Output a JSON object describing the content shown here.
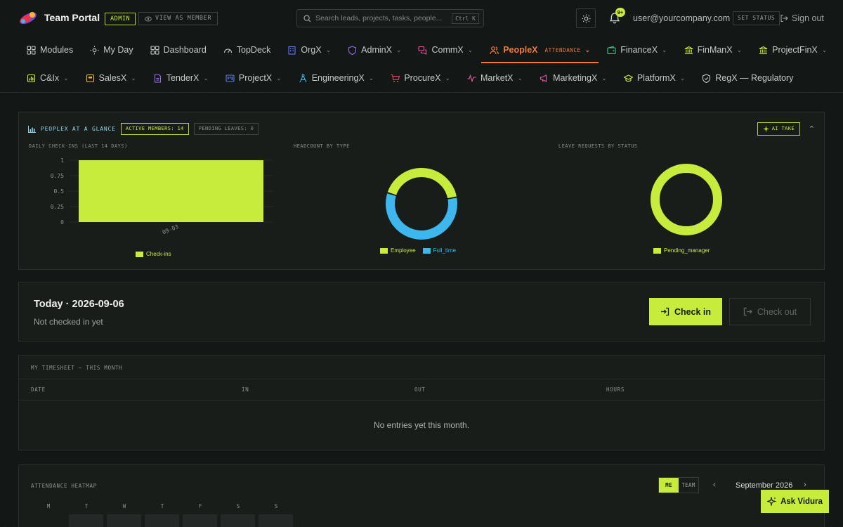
{
  "header": {
    "brand": "Team Portal",
    "role_badge": "ADMIN",
    "view_as_label": "VIEW AS MEMBER",
    "search_placeholder": "Search leads, projects, tasks, people...",
    "search_shortcut": "Ctrl K",
    "notification_count": "9+",
    "user_email": "user@yourcompany.com",
    "set_status_label": "SET STATUS",
    "sign_out_label": "Sign out"
  },
  "nav": {
    "row1": [
      {
        "label": "Modules",
        "icon": "grid-icon",
        "dropdown": false
      },
      {
        "label": "My Day",
        "icon": "sun-icon",
        "dropdown": false
      },
      {
        "label": "Dashboard",
        "icon": "grid-icon",
        "dropdown": false
      },
      {
        "label": "TopDeck",
        "icon": "gauge-icon",
        "dropdown": false
      },
      {
        "label": "OrgX",
        "icon": "building-icon",
        "dropdown": true
      },
      {
        "label": "AdminX",
        "icon": "shield-icon",
        "dropdown": true
      },
      {
        "label": "CommX",
        "icon": "chat-icon",
        "dropdown": true
      },
      {
        "label": "PeopleX",
        "icon": "people-icon",
        "dropdown": true,
        "active": true,
        "sub": "ATTENDANCE"
      },
      {
        "label": "FinanceX",
        "icon": "wallet-icon",
        "dropdown": true
      },
      {
        "label": "FinManX",
        "icon": "bank-icon",
        "dropdown": true
      },
      {
        "label": "ProjectFinX",
        "icon": "bank-icon",
        "dropdown": true
      }
    ],
    "row2": [
      {
        "label": "C&Ix",
        "icon": "flask-icon",
        "dropdown": true
      },
      {
        "label": "SalesX",
        "icon": "badge-icon",
        "dropdown": true
      },
      {
        "label": "TenderX",
        "icon": "document-icon",
        "dropdown": true
      },
      {
        "label": "ProjectX",
        "icon": "kanban-icon",
        "dropdown": true
      },
      {
        "label": "EngineeringX",
        "icon": "compass-icon",
        "dropdown": true
      },
      {
        "label": "ProcureX",
        "icon": "cart-icon",
        "dropdown": true
      },
      {
        "label": "MarketX",
        "icon": "pulse-icon",
        "dropdown": true
      },
      {
        "label": "MarketingX",
        "icon": "megaphone-icon",
        "dropdown": true
      },
      {
        "label": "PlatformX",
        "icon": "graduation-icon",
        "dropdown": true
      },
      {
        "label": "RegX — Regulatory",
        "icon": "shield-check-icon",
        "dropdown": false
      }
    ]
  },
  "glance": {
    "title": "PEOPLEX AT A GLANCE",
    "active_members": "ACTIVE MEMBERS: 14",
    "pending_leaves": "PENDING LEAVES: 0",
    "ai_take_label": "AI TAKE",
    "charts": {
      "checkins_caption": "DAILY CHECK-INS (LAST 14 DAYS)",
      "headcount_caption": "HEADCOUNT BY TYPE",
      "leave_caption": "LEAVE REQUESTS BY STATUS"
    }
  },
  "chart_data": [
    {
      "type": "bar",
      "title": "DAILY CHECK-INS (LAST 14 DAYS)",
      "categories": [
        "09-03"
      ],
      "series": [
        {
          "name": "Check-ins",
          "values": [
            1
          ]
        }
      ],
      "ylim": [
        0,
        1
      ],
      "yticks": [
        "1",
        "0.75",
        "0.5",
        "0.25",
        "0"
      ],
      "grid": true,
      "legend": "bottom",
      "colors": [
        "#c8ec3c"
      ]
    },
    {
      "type": "pie",
      "title": "HEADCOUNT BY TYPE",
      "donut": true,
      "labels": [
        "Employee",
        "Full_time"
      ],
      "values": [
        0.42,
        0.58
      ],
      "legend": "bottom",
      "colors": [
        "#c8ec3c",
        "#3db7ee"
      ]
    },
    {
      "type": "pie",
      "title": "LEAVE REQUESTS BY STATUS",
      "donut": true,
      "labels": [
        "Pending_manager"
      ],
      "values": [
        1
      ],
      "legend": "bottom",
      "colors": [
        "#c8ec3c"
      ]
    }
  ],
  "today": {
    "title": "Today · 2026-09-06",
    "status": "Not checked in yet",
    "check_in_label": "Check in",
    "check_out_label": "Check out"
  },
  "timesheet": {
    "title": "MY TIMESHEET — THIS MONTH",
    "columns": [
      "DATE",
      "IN",
      "OUT",
      "HOURS"
    ],
    "empty_message": "No entries yet this month."
  },
  "heatmap": {
    "title": "ATTENDANCE HEATMAP",
    "toggle": [
      "ME",
      "TEAM"
    ],
    "month": "September 2026",
    "weekdays": [
      "M",
      "T",
      "W",
      "T",
      "F",
      "S",
      "S"
    ]
  },
  "ask_label": "Ask Vidura",
  "colors": {
    "accent": "#c8ec3c",
    "active_nav": "#f07a3b",
    "info_blue": "#3db7ee",
    "background": "#131715"
  }
}
